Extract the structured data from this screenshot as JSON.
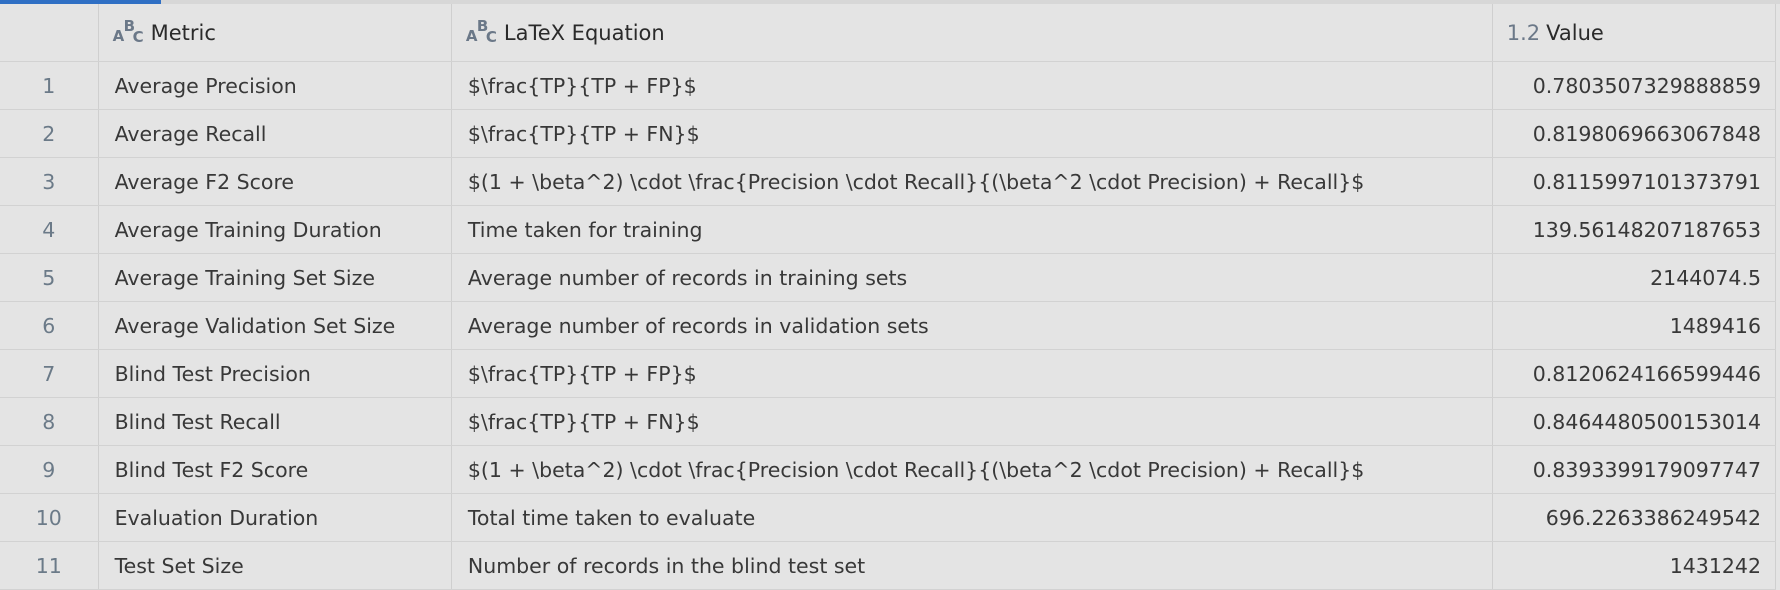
{
  "grid": {
    "columns": {
      "metric": {
        "label": "Metric",
        "type_icon": "text-type-icon"
      },
      "equation": {
        "label": "LaTeX Equation",
        "type_icon": "text-type-icon"
      },
      "value": {
        "label": "Value",
        "type_icon": "numeric-type-icon",
        "type_glyph": "1.2"
      }
    },
    "rows": [
      {
        "idx": "1",
        "metric": "Average Precision",
        "equation": "$\\frac{TP}{TP + FP}$",
        "value": "0.7803507329888859"
      },
      {
        "idx": "2",
        "metric": "Average Recall",
        "equation": "$\\frac{TP}{TP + FN}$",
        "value": "0.8198069663067848"
      },
      {
        "idx": "3",
        "metric": "Average F2 Score",
        "equation": "$(1 + \\beta^2) \\cdot \\frac{Precision \\cdot Recall}{(\\beta^2 \\cdot Precision) + Recall}$",
        "value": "0.8115997101373791"
      },
      {
        "idx": "4",
        "metric": "Average Training Duration",
        "equation": "Time taken for training",
        "value": "139.56148207187653"
      },
      {
        "idx": "5",
        "metric": "Average Training Set Size",
        "equation": "Average number of records in training sets",
        "value": "2144074.5"
      },
      {
        "idx": "6",
        "metric": "Average Validation Set Size",
        "equation": "Average number of records in validation sets",
        "value": "1489416"
      },
      {
        "idx": "7",
        "metric": "Blind Test Precision",
        "equation": "$\\frac{TP}{TP + FP}$",
        "value": "0.8120624166599446"
      },
      {
        "idx": "8",
        "metric": "Blind Test Recall",
        "equation": "$\\frac{TP}{TP + FN}$",
        "value": "0.8464480500153014"
      },
      {
        "idx": "9",
        "metric": "Blind Test F2 Score",
        "equation": "$(1 + \\beta^2) \\cdot \\frac{Precision \\cdot Recall}{(\\beta^2 \\cdot Precision) + Recall}$",
        "value": "0.8393399179097747"
      },
      {
        "idx": "10",
        "metric": "Evaluation Duration",
        "equation": "Total time taken to evaluate",
        "value": "696.2263386249542"
      },
      {
        "idx": "11",
        "metric": "Test Set Size",
        "equation": "Number of records in the blind test set",
        "value": "1431242"
      }
    ]
  },
  "colors": {
    "background": "#e4e4e4",
    "accent": "#2f6fc4",
    "row_index": "#6b7a88",
    "type_icon": "#6b7888"
  }
}
